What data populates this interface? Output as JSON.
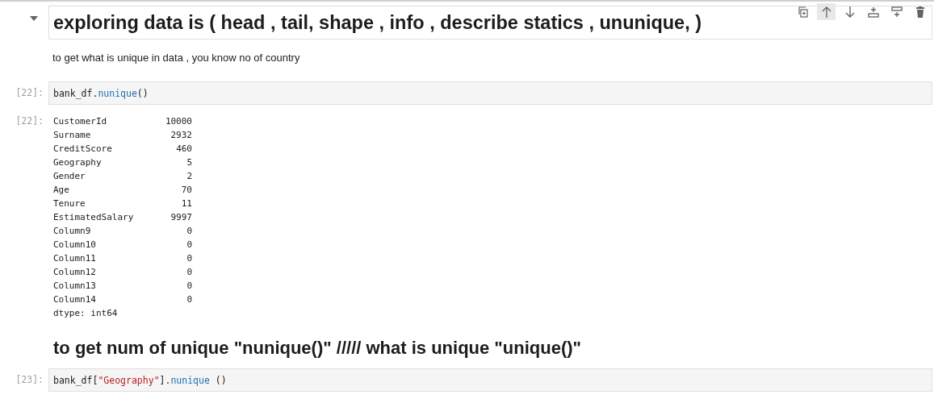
{
  "toolbar": [
    {
      "kind": "duplicate",
      "active": false
    },
    {
      "kind": "move-up",
      "active": true
    },
    {
      "kind": "move-down",
      "active": false
    },
    {
      "kind": "insert-above",
      "active": false
    },
    {
      "kind": "insert-below",
      "active": false
    },
    {
      "kind": "delete",
      "active": false
    }
  ],
  "cells": [
    {
      "kind": "heading",
      "collapsed": false,
      "text": "exploring data is ( head , tail, shape , info , describe statics , ununique, )"
    },
    {
      "kind": "paragraph",
      "text": "to get what is unique in data , you know no of country"
    },
    {
      "kind": "code",
      "prompt": "[22]:",
      "tokens": [
        {
          "kind": "plain",
          "text": "bank_df."
        },
        {
          "kind": "method",
          "text": "nunique"
        },
        {
          "kind": "plain",
          "text": "()"
        }
      ]
    },
    {
      "kind": "output",
      "prompt": "[22]:",
      "rows": [
        {
          "name": "CustomerId",
          "value": "10000"
        },
        {
          "name": "Surname",
          "value": "2932"
        },
        {
          "name": "CreditScore",
          "value": "460"
        },
        {
          "name": "Geography",
          "value": "5"
        },
        {
          "name": "Gender",
          "value": "2"
        },
        {
          "name": "Age",
          "value": "70"
        },
        {
          "name": "Tenure",
          "value": "11"
        },
        {
          "name": "EstimatedSalary",
          "value": "9997"
        },
        {
          "name": "Column9",
          "value": "0"
        },
        {
          "name": "Column10",
          "value": "0"
        },
        {
          "name": "Column11",
          "value": "0"
        },
        {
          "name": "Column12",
          "value": "0"
        },
        {
          "name": "Column13",
          "value": "0"
        },
        {
          "name": "Column14",
          "value": "0"
        }
      ],
      "footer": "dtype: int64"
    },
    {
      "kind": "subheading",
      "text": "to get num of unique \"nunique()\" ///// what is unique \"unique()\""
    },
    {
      "kind": "code",
      "prompt": "[23]:",
      "tokens": [
        {
          "kind": "plain",
          "text": "bank_df["
        },
        {
          "kind": "string",
          "text": "\"Geography\""
        },
        {
          "kind": "plain",
          "text": "]."
        },
        {
          "kind": "method",
          "text": "nunique"
        },
        {
          "kind": "plain",
          "text": " ()"
        }
      ]
    }
  ]
}
